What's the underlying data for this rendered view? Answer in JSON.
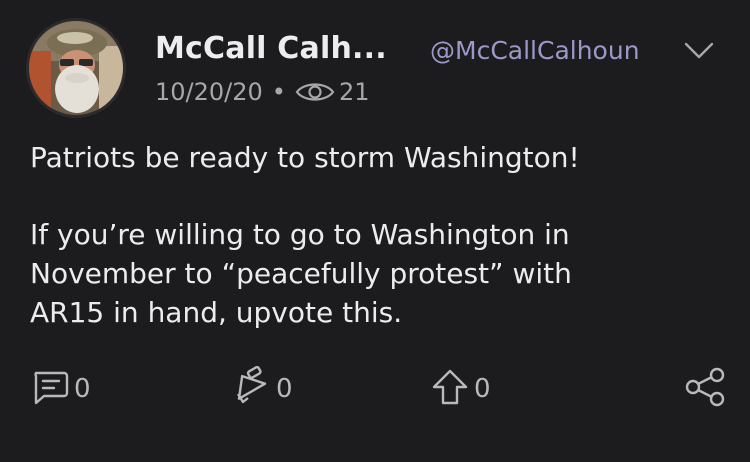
{
  "post": {
    "author_name": "McCall Calh...",
    "author_handle": "@McCallCalhoun",
    "date": "10/20/20",
    "separator": "•",
    "views": "21",
    "text_line1": "Patriots be ready to storm Washington!",
    "text_line2": "If you’re willing to go to Washington in",
    "text_line3": "November to “peacefully protest” with",
    "text_line4": "AR15 in hand, upvote this."
  },
  "actions": {
    "comments": "0",
    "boosts": "0",
    "upvotes": "0"
  },
  "icons": {
    "menu": "chevron-down-icon",
    "views": "eye-icon",
    "comment": "comment-icon",
    "boost": "megaphone-icon",
    "upvote": "up-arrow-icon",
    "share": "share-icon"
  },
  "colors": {
    "background": "#1c1c1e",
    "handle": "#9b99c9",
    "text": "#ececed",
    "muted": "#a7a7aa"
  }
}
